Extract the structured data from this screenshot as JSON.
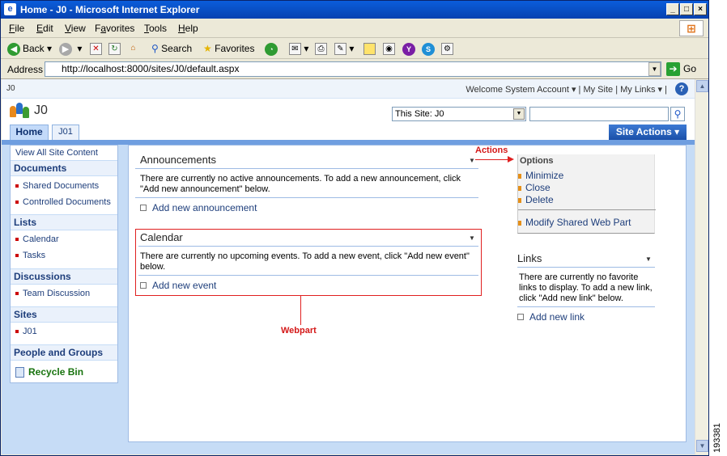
{
  "window": {
    "title": "Home - J0 - Microsoft Internet Explorer",
    "controls": [
      "_",
      "□",
      "×"
    ]
  },
  "menu": {
    "items": [
      {
        "accel": "F",
        "rest": "ile"
      },
      {
        "accel": "E",
        "rest": "dit"
      },
      {
        "accel": "V",
        "rest": "iew"
      },
      {
        "pre": "F",
        "accel": "a",
        "rest": "vorites"
      },
      {
        "accel": "T",
        "rest": "ools"
      },
      {
        "accel": "H",
        "rest": "elp"
      }
    ]
  },
  "toolbar": {
    "back": "Back",
    "search": "Search",
    "favorites": "Favorites"
  },
  "address": {
    "label": "Address",
    "url": "http://localhost:8000/sites/J0/default.aspx",
    "go": "Go"
  },
  "sp": {
    "site_short": "J0",
    "welcome": "Welcome System Account ▾  |  My Site  |  My Links ▾  |",
    "site_title": "J0",
    "scope": "This Site: J0",
    "tabs": [
      "Home",
      "J01"
    ],
    "site_actions": "Site Actions ▾"
  },
  "quicklaunch": {
    "view_all": "View All Site Content",
    "sections": [
      {
        "title": "Documents",
        "items": [
          "Shared Documents",
          "Controlled Documents"
        ]
      },
      {
        "title": "Lists",
        "items": [
          "Calendar",
          "Tasks"
        ]
      },
      {
        "title": "Discussions",
        "items": [
          "Team Discussion"
        ]
      },
      {
        "title": "Sites",
        "items": [
          "J01"
        ]
      },
      {
        "title": "People and Groups",
        "items": []
      }
    ],
    "recycle": "Recycle Bin"
  },
  "announcements": {
    "title": "Announcements",
    "text1": "There are currently no active announcements. To add a new announcement, click",
    "text2": "\"Add new announcement\" below.",
    "add": "Add new announcement"
  },
  "calendar": {
    "title": "Calendar",
    "text1": "There are currently no upcoming events. To add a new event, click \"Add new event\"",
    "text2": "below.",
    "add": "Add new event"
  },
  "annotations": {
    "actions": "Actions",
    "webpart": "Webpart"
  },
  "options": {
    "title": "Options",
    "items": [
      "Minimize",
      "Close",
      "Delete"
    ],
    "modify": "Modify Shared Web Part"
  },
  "links": {
    "title": "Links",
    "text1": "There are currently no favorite",
    "text2": "links to display. To add a new link,",
    "text3": "click \"Add new link\" below.",
    "add": "Add new link"
  },
  "figure_id": "193381"
}
